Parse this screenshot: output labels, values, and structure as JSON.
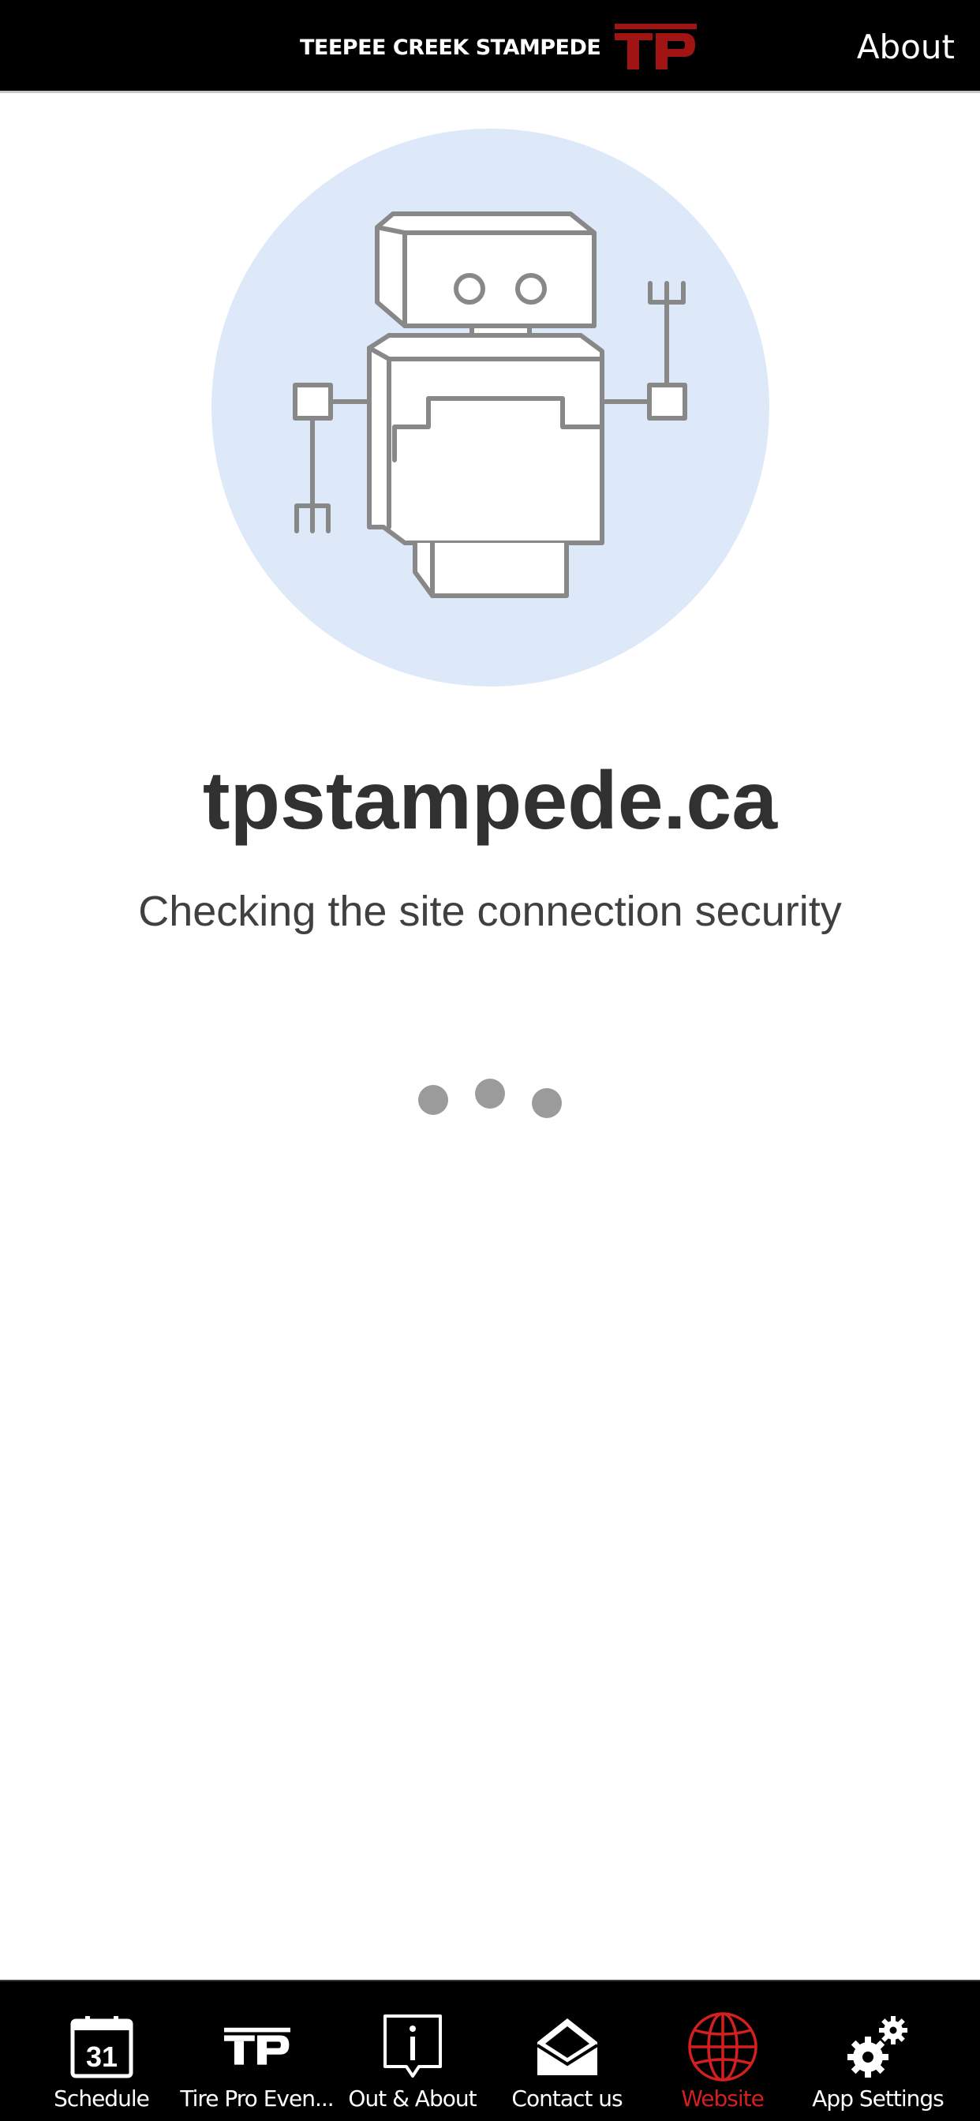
{
  "header": {
    "brand_text": "TEEPEE CREEK STAMPEDE",
    "logo_text": "TP",
    "logo_color": "#a01414",
    "about_label": "About"
  },
  "main": {
    "domain": "tpstampede.ca",
    "status": "Checking the site connection security",
    "illustration_bg": "#dde9f9",
    "illustration_stroke": "#888888"
  },
  "tabbar": {
    "active_color": "#d41f1f",
    "items": [
      {
        "label": "Schedule",
        "icon": "calendar-icon",
        "icon_text": "31"
      },
      {
        "label": "Tire Pro Even...",
        "icon": "tp-logo-icon",
        "icon_text": "TP"
      },
      {
        "label": "Out & About",
        "icon": "info-icon",
        "icon_text": "i"
      },
      {
        "label": "Contact us",
        "icon": "envelope-icon"
      },
      {
        "label": "Website",
        "icon": "globe-icon",
        "active": true
      },
      {
        "label": "App Settings",
        "icon": "gears-icon"
      }
    ]
  }
}
